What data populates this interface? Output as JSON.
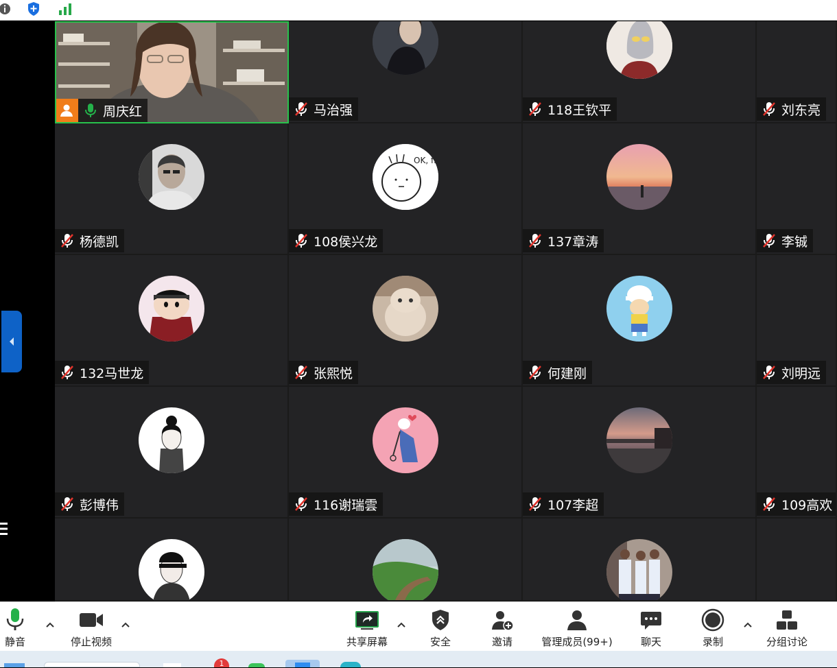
{
  "toolbar": {
    "mute_label": "静音",
    "stop_video_label": "停止视频",
    "share_label": "共享屏幕",
    "security_label": "安全",
    "invite_label": "邀请",
    "participants_label": "管理成员(99+)",
    "chat_label": "聊天",
    "record_label": "录制",
    "breakout_label": "分组讨论"
  },
  "taskbar": {
    "badge_count": "1"
  },
  "participants": [
    {
      "name": "周庆红",
      "active": true
    },
    {
      "name": "马治强"
    },
    {
      "name": "118王钦平"
    },
    {
      "name": "刘东亮"
    },
    {
      "name": "杨德凯"
    },
    {
      "name": "108侯兴龙"
    },
    {
      "name": "137章涛"
    },
    {
      "name": "李铖"
    },
    {
      "name": "132马世龙"
    },
    {
      "name": "张熙悦"
    },
    {
      "name": "何建刚"
    },
    {
      "name": "刘明远"
    },
    {
      "name": "彭博伟"
    },
    {
      "name": "116谢瑞雲"
    },
    {
      "name": "107李超"
    },
    {
      "name": "109高欢"
    }
  ],
  "avatar_texts": {
    "okfine": "OK, fine"
  },
  "colors": {
    "accent_blue": "#0e62c7",
    "active_border": "#27c24c",
    "mic_green": "#24b14a",
    "muted_red": "#e0342c"
  }
}
